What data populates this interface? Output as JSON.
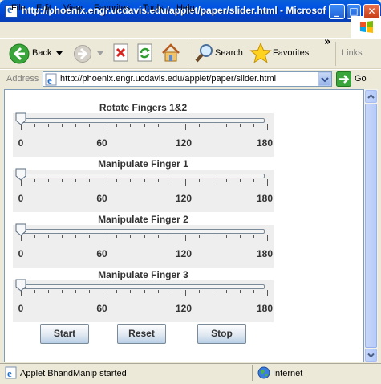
{
  "window": {
    "title": "http://phoenix.engr.ucdavis.edu/applet/paper/slider.html - Microsoft I...",
    "minimize": "_",
    "maximize": "□",
    "close": "✕"
  },
  "menu": [
    "File",
    "Edit",
    "View",
    "Favorites",
    "Tools",
    "Help"
  ],
  "toolbar": {
    "back": "Back",
    "search": "Search",
    "favorites": "Favorites",
    "chevron": "»",
    "links": "Links"
  },
  "address": {
    "label": "Address",
    "url": "http://phoenix.engr.ucdavis.edu/applet/paper/slider.html",
    "go": "Go"
  },
  "applet": {
    "sliders": [
      {
        "title": "Rotate Fingers 1&2",
        "value": 0,
        "min": 0,
        "max": 180
      },
      {
        "title": "Manipulate Finger 1",
        "value": 0,
        "min": 0,
        "max": 180
      },
      {
        "title": "Manipulate Finger 2",
        "value": 0,
        "min": 0,
        "max": 180
      },
      {
        "title": "Manipulate Finger 3",
        "value": 0,
        "min": 0,
        "max": 180
      }
    ],
    "tick_labels": [
      "0",
      "60",
      "120",
      "180"
    ],
    "buttons": {
      "start": "Start",
      "reset": "Reset",
      "stop": "Stop"
    }
  },
  "status": {
    "text": "Applet BhandManip started",
    "zone": "Internet"
  }
}
